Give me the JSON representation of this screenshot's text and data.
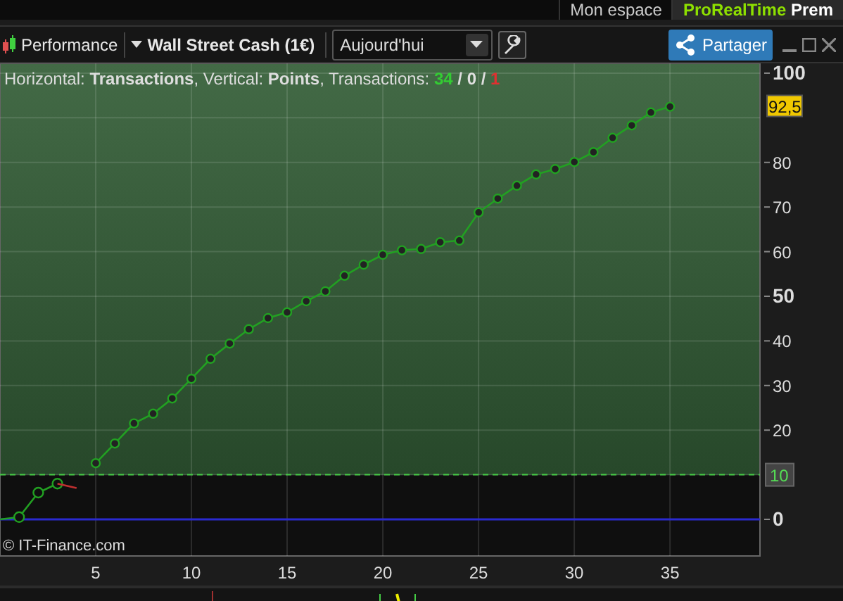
{
  "top_tabs": [
    {
      "label": "Mon espace",
      "selected": false
    },
    {
      "brand": "ProRealTime",
      "label": "Prem",
      "selected": true
    }
  ],
  "toolbar": {
    "chart_type": "Performance",
    "instrument": "Wall Street Cash (1€)",
    "period": "Aujourd'hui",
    "share_button": "Partager"
  },
  "chart": {
    "info": "Horizontal: **Transactions**, Vertical: **Points**, Transactions:",
    "counts": [
      {
        "value": "34",
        "color": "#33cc33"
      },
      {
        "value": "0",
        "color": "#e0e0e0"
      },
      {
        "value": "1",
        "color": "#e03030"
      }
    ],
    "separator": "/",
    "last_value": "92,5",
    "copyright": "© IT-Finance.com",
    "chart_data": {
      "type": "line",
      "x": [
        0,
        1,
        2,
        3,
        4,
        5,
        6,
        7,
        8,
        9,
        10,
        11,
        12,
        13,
        14,
        15,
        16,
        17,
        18,
        19,
        20,
        21,
        22,
        23,
        24,
        25,
        26,
        27,
        28,
        29,
        30,
        31,
        32,
        33,
        34,
        35
      ],
      "series": [
        {
          "color": "#22a022",
          "marker": "o",
          "values": [
            0,
            0.5,
            6,
            8,
            null,
            12.6,
            17,
            21.5,
            23.7,
            27.1,
            31.5,
            36,
            39.4,
            42.6,
            45.1,
            46.4,
            48.9,
            51.1,
            54.6,
            57.1,
            59.3,
            60.3,
            60.6,
            62.1,
            62.5,
            68.8,
            71.9,
            74.8,
            77.3,
            78.5,
            80.1,
            82.3,
            85.5,
            88.3,
            91.2,
            92.5
          ]
        },
        {
          "color": "#c03030",
          "values": [
            null,
            null,
            null,
            8,
            7,
            null,
            null,
            null,
            null,
            null,
            null,
            null,
            null,
            null,
            null,
            null,
            null,
            null,
            null,
            null,
            null,
            null,
            null,
            null,
            null,
            null,
            null,
            null,
            null,
            null,
            null,
            null,
            null,
            null,
            null,
            null
          ]
        }
      ],
      "xlim": [
        0,
        39.7
      ],
      "ylim": [
        -8.2,
        102.2
      ],
      "xticks": [
        5,
        10,
        15,
        20,
        25,
        30,
        35
      ],
      "yticks": [
        0,
        20,
        30,
        40,
        50,
        60,
        70,
        80,
        100
      ],
      "grid": true,
      "ref_lines": [
        {
          "axis": "y",
          "value": 10,
          "label": "10",
          "color": "#44cc44"
        },
        {
          "axis": "y",
          "value": 0,
          "color": "#2a2ad0"
        }
      ]
    }
  }
}
